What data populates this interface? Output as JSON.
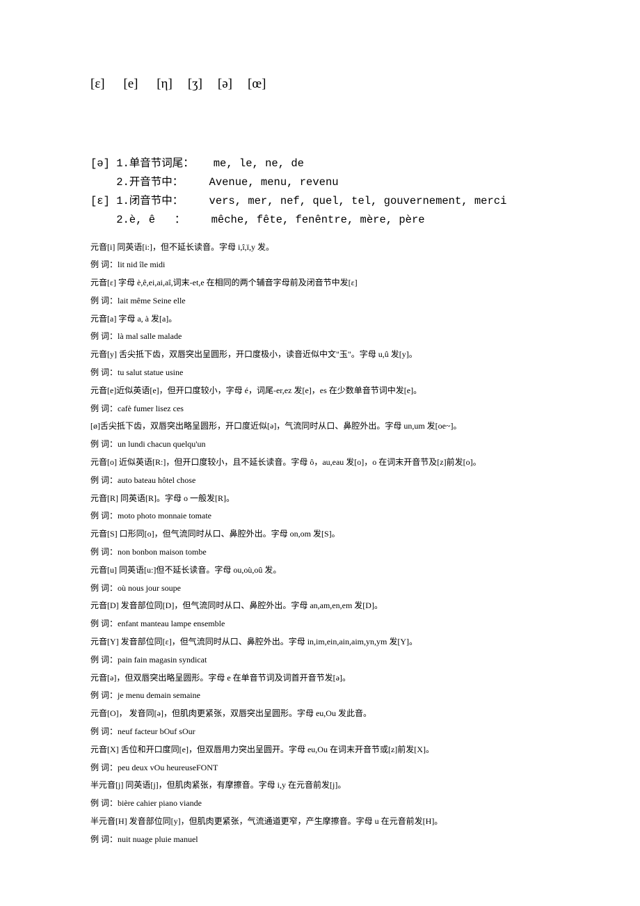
{
  "phonetics": [
    "[ε]",
    "[e]",
    "[η]",
    "[ʒ]",
    "[ə]",
    "[œ]"
  ],
  "rules": [
    "[ə] 1.单音节词尾：   me, le, ne, de",
    "    2.开音节中：    Avenue, menu, revenu",
    "[ε] 1.闭音节中：    vers, mer, nef, quel, tel, gouvernement, merci",
    "    2.è, ê   ：    mêche, fête, fenêntre, mère, père"
  ],
  "notes": [
    "元音[i]  同英语[i:]，但不延长读音。字母 i,î,ï,y 发。",
    "例  词：lit nid île midi",
    "元音[ε]  字母 è,ê,ei,ai,aî,词末-et,e 在相同的两个辅音字母前及闭音节中发[ε]",
    "例  词：lait même Seine elle",
    "元音[a]  字母 a, à 发[a]。",
    "例  词：là mal salle malade",
    "元音[y] 舌尖抵下齿，双唇突出呈圆形，开口度极小，读音近似中文\"玉\"。字母 u,û 发[y]。",
    "例  词：tu salut statue usine",
    "元音[e]近似英语[e]，但开口度较小，字母 é，词尾-er,ez 发[e]，es 在少数单音节词中发[e]。",
    "例  词：cafè fumer lisez ces",
    "[ø]舌尖抵下齿，双唇突出略呈圆形，开口度近似[ə]，气流同时从口、鼻腔外出。字母 un,um 发[oe~]。",
    "例  词：un lundi chacun quelqu'un",
    "元音[o]  近似英语[R:]，但开口度较小，且不延长读音。字母 ô，au,eau 发[o]，o 在词末开音节及[z]前发[o]。",
    "例  词：auto bateau hôtel chose",
    "元音[R]  同英语[R]。字母 o 一般发[R]。",
    "例  词：moto photo monnaie tomate",
    "元音[S]  口形同[o]，但气流同时从口、鼻腔外出。字母 on,om 发[S]。",
    "例  词：non bonbon maison tombe",
    "元音[u]  同英语[u:]但不延长读音。字母 ou,où,oû 发。",
    "例  词：où nous jour soupe",
    "元音[D]  发音部位同[D]，但气流同时从口、鼻腔外出。字母 an,am,en,em 发[D]。",
    "例  词：enfant manteau lampe ensemble",
    "元音[Y]  发音部位同[ε]，但气流同时从口、鼻腔外出。字母 in,im,ein,ain,aim,yn,ym 发[Y]。",
    "例  词：pain fain magasin syndicat",
    "元音[ə]，但双唇突出略呈圆形。字母 e 在单音节词及词首开音节发[ə]。",
    "例  词：je menu demain semaine",
    "元音[O]，  发音同[ə]，但肌肉更紧张，双唇突出呈圆形。字母 eu,Ou 发此音。",
    "例  词：neuf facteur bOuf sOur",
    "元音[X]  舌位和开口度同[e]，但双唇用力突出呈圆开。字母 eu,Ou 在词末开音节或[z]前发[X]。",
    "例  词：peu deux vOu heureuseFONT",
    "半元音[j]  同英语[j]，但肌肉紧张，有摩擦音。字母 i,y 在元音前发[j]。",
    "例  词：bière cahier piano viande",
    "半元音[H]  发音部位同[y]，但肌肉更紧张，气流通道更窄，产生摩擦音。字母 u 在元音前发[H]。",
    "例  词：nuit nuage pluie manuel"
  ]
}
